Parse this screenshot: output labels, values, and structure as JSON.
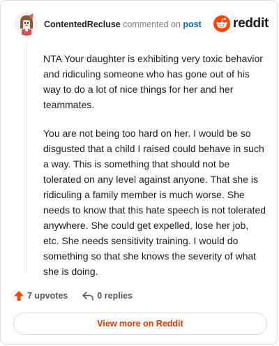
{
  "comment": {
    "author": "ContentedRecluse",
    "action": "commented on",
    "target": "post",
    "paragraphs": [
      "NTA Your daughter is exhibiting very toxic behavior and ridiculing someone who has gone out of his way to do a lot of nice things for her and her teammates.",
      "You are not being too hard on her. I would be so disgusted that a child I raised could behave in such a way. This is something that should not be tolerated on any level against anyone. That she is ridiculing a family member is much worse. She needs to know that this hate speech is not tolerated anywhere. She could get expelled, lose her job, etc. She needs sensitivity training. I would do something so that she knows the severity of what she is doing."
    ]
  },
  "brand": {
    "name": "reddit",
    "icon": "reddit-logo-icon",
    "accent": "#ff4500"
  },
  "footer": {
    "upvotes": "7 upvotes",
    "replies": "0 replies",
    "upvote_icon": "upvote-arrow-icon",
    "reply_icon": "reply-arrow-icon",
    "upvote_color": "#ff4500"
  },
  "actions": {
    "view_more": "View more on Reddit"
  }
}
